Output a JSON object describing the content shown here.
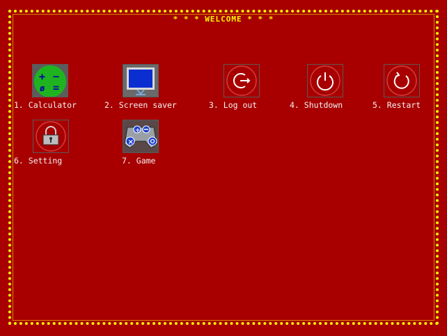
{
  "title": "* * * WELCOME * * *",
  "colors": {
    "background": "#a80000",
    "frame": "#f5f500",
    "label_text": "#f2f2f2",
    "tile_border": "#5a5a5a"
  },
  "apps": [
    {
      "label": "1. Calculator",
      "icon": "calculator-icon"
    },
    {
      "label": "2. Screen saver",
      "icon": "monitor-icon"
    },
    {
      "label": "3. Log out",
      "icon": "logout-icon"
    },
    {
      "label": "4. Shutdown",
      "icon": "power-icon"
    },
    {
      "label": "5. Restart",
      "icon": "restart-icon"
    },
    {
      "label": "6. Setting",
      "icon": "lock-icon"
    },
    {
      "label": "7. Game",
      "icon": "gamepad-icon"
    }
  ]
}
